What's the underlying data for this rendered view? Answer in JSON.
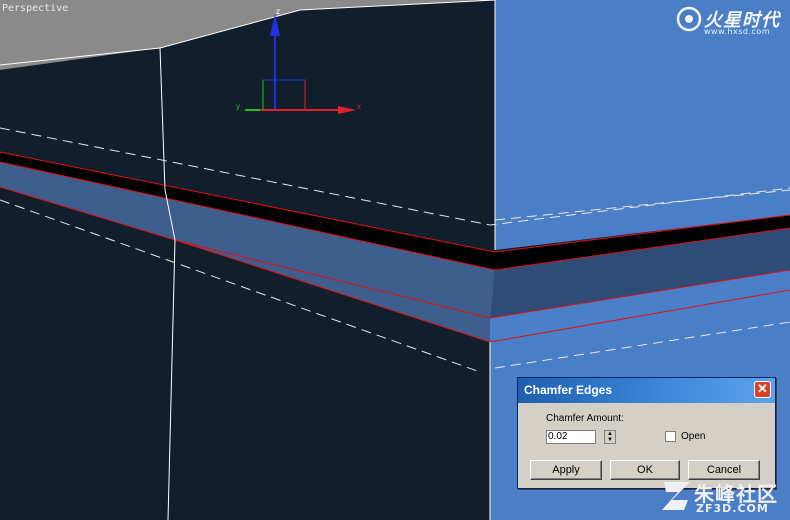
{
  "viewport": {
    "label": "Perspective",
    "gizmo": {
      "x_label": "x",
      "y_label": "y",
      "z_label": "z",
      "x_color": "#e0202a",
      "y_color": "#20c020",
      "z_color": "#2030e0"
    }
  },
  "colors": {
    "dark_face": "#111e2c",
    "light_face": "#4a7ec6",
    "band_face": "#3e5e8e",
    "selected_edge": "#e01010",
    "wire": "#ffffff",
    "dialog_bg": "#d4d0c8"
  },
  "logo_top": {
    "brand": "火星时代",
    "url": "www.hxsd.com"
  },
  "dialog": {
    "title": "Chamfer Edges",
    "close_icon": "close-icon",
    "amount_label": "Chamfer Amount:",
    "amount_value": "0.02",
    "open_label": "Open",
    "open_checked": false,
    "apply_label": "Apply",
    "ok_label": "OK",
    "cancel_label": "Cancel"
  },
  "watermark": {
    "cn": "朱峰社区",
    "en": "ZF3D.COM"
  }
}
